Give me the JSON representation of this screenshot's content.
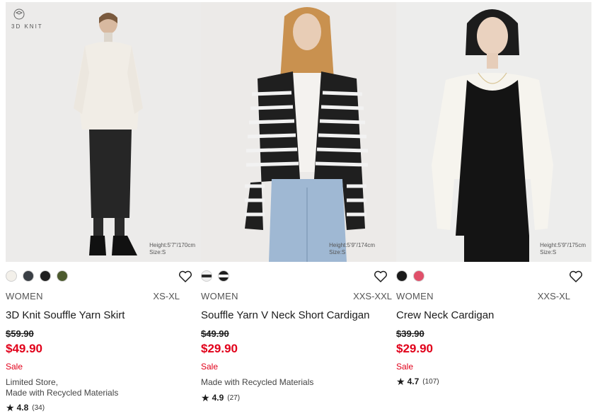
{
  "products": [
    {
      "badge_text": "3D KNIT",
      "model_height": "Height:5'7\"/170cm",
      "model_size": "Size:S",
      "swatches": [
        "#f3f0ea",
        "#3a3f45",
        "#1f1f1f",
        "#4c5a2e"
      ],
      "gender": "WOMEN",
      "sizes": "XS-XL",
      "name": "3D Knit Souffle Yarn Skirt",
      "original_price": "$59.90",
      "sale_price": "$49.90",
      "sale_label": "Sale",
      "flags": [
        "Limited Store,",
        "Made with Recycled Materials"
      ],
      "rating": "4.8",
      "review_count": "(34)"
    },
    {
      "model_height": "Height:5'9\"/174cm",
      "model_size": "Size:S",
      "swatches": [
        "stripe-light",
        "stripe-dark"
      ],
      "gender": "WOMEN",
      "sizes": "XXS-XXL",
      "name": "Souffle Yarn V Neck Short Cardigan",
      "original_price": "$49.90",
      "sale_price": "$29.90",
      "sale_label": "Sale",
      "flags": [
        "Made with Recycled Materials"
      ],
      "rating": "4.9",
      "review_count": "(27)"
    },
    {
      "model_height": "Height:5'9\"/175cm",
      "model_size": "Size:S",
      "swatches": [
        "#1a1a1a",
        "#e0506a"
      ],
      "gender": "WOMEN",
      "sizes": "XXS-XL",
      "name": "Crew Neck Cardigan",
      "original_price": "$39.90",
      "sale_price": "$29.90",
      "sale_label": "Sale",
      "flags": [],
      "rating": "4.7",
      "review_count": "(107)"
    }
  ],
  "colors": {
    "sale_red": "#e1001a",
    "text": "#1b1b1b"
  },
  "icons": {
    "favorite": "heart-outline-icon",
    "rating": "star-icon",
    "badge": "3d-knit-logo-icon"
  }
}
